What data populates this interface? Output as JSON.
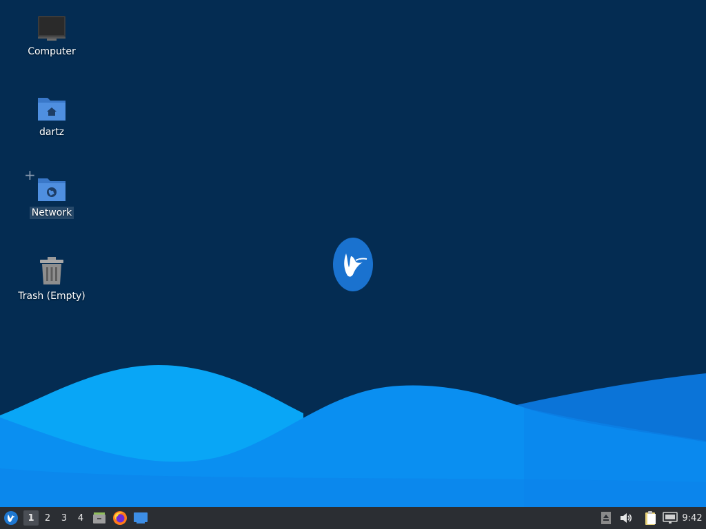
{
  "desktop": {
    "icons": [
      {
        "id": "computer",
        "label": "Computer",
        "icon": "monitor-icon"
      },
      {
        "id": "home",
        "label": "dartz",
        "icon": "home-folder-icon"
      },
      {
        "id": "network",
        "label": "Network",
        "icon": "network-folder-icon",
        "selected": true
      },
      {
        "id": "trash",
        "label": "Trash (Empty)",
        "icon": "trash-icon"
      }
    ],
    "logo": "xubuntu-bird-logo",
    "colors": {
      "background": "#042c52",
      "wave_light": "#0aa4f5",
      "wave_mid": "#0a8cf0",
      "wave_dark": "#0b6fd4"
    }
  },
  "panel": {
    "whisker_menu_icon": "xubuntu-menu-icon",
    "workspaces": [
      "1",
      "2",
      "3",
      "4"
    ],
    "active_workspace": "1",
    "launchers": [
      {
        "name": "files-launcher",
        "icon": "file-manager-icon"
      },
      {
        "name": "firefox-launcher",
        "icon": "firefox-icon"
      },
      {
        "name": "show-desktop-launcher",
        "icon": "show-desktop-icon"
      }
    ],
    "tray": [
      "removable-media-icon",
      "volume-icon",
      "clipboard-icon",
      "network-wired-icon"
    ],
    "clock": "9:42"
  }
}
